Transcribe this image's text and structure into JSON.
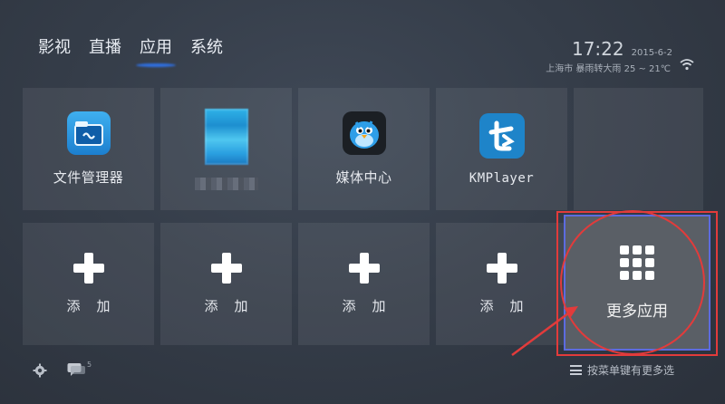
{
  "nav": {
    "items": [
      {
        "label": "影视"
      },
      {
        "label": "直播"
      },
      {
        "label": "应用"
      },
      {
        "label": "系统"
      }
    ],
    "active_index": 2,
    "active_color": "#2f6fe0"
  },
  "status": {
    "time": "17:22",
    "date": "2015-6-2",
    "weather": "上海市 暴雨转大雨 25 ~ 21℃",
    "wifi_icon": "wifi-icon"
  },
  "apps": [
    {
      "label": "文件管理器",
      "icon": "file-manager-icon"
    },
    {
      "label": "",
      "icon": "blurred-app-icon"
    },
    {
      "label": "媒体中心",
      "icon": "media-center-bird-icon"
    },
    {
      "label": "KMPlayer",
      "icon": "kmplayer-icon"
    }
  ],
  "add_tiles": [
    {
      "label": "添加"
    },
    {
      "label": "添加"
    },
    {
      "label": "添加"
    },
    {
      "label": "添加"
    }
  ],
  "more_apps": {
    "label": "更多应用",
    "icon": "grid-icon",
    "focus_color": "#5c6be0"
  },
  "annotation_color": "#e23b3b",
  "footer": {
    "settings_icon": "gear-icon",
    "message_icon": "message-icon",
    "message_badge": "5",
    "hint": "按菜单键有更多选"
  }
}
